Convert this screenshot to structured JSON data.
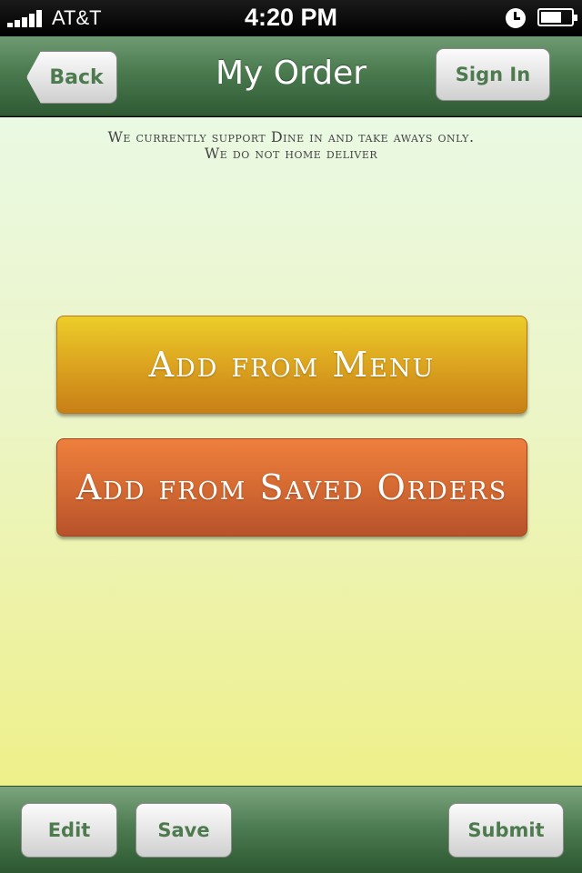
{
  "status_bar": {
    "carrier": "AT&T",
    "time": "4:20 PM",
    "icons": [
      "signal-icon",
      "alarm-icon",
      "battery-icon"
    ]
  },
  "nav": {
    "back_label": "Back",
    "title": "My Order",
    "signin_label": "Sign In"
  },
  "main": {
    "notice_line1": "We currently support Dine in and take aways only.",
    "notice_line2": "We do not home deliver",
    "add_menu_label": "Add from Menu",
    "add_saved_label": "Add from Saved Orders"
  },
  "toolbar": {
    "edit_label": "Edit",
    "save_label": "Save",
    "submit_label": "Submit"
  },
  "colors": {
    "nav_green": "#4b7a4f",
    "button_text_green": "#4d7a4e",
    "menu_button": "#dca41f",
    "saved_button": "#d56a32"
  }
}
